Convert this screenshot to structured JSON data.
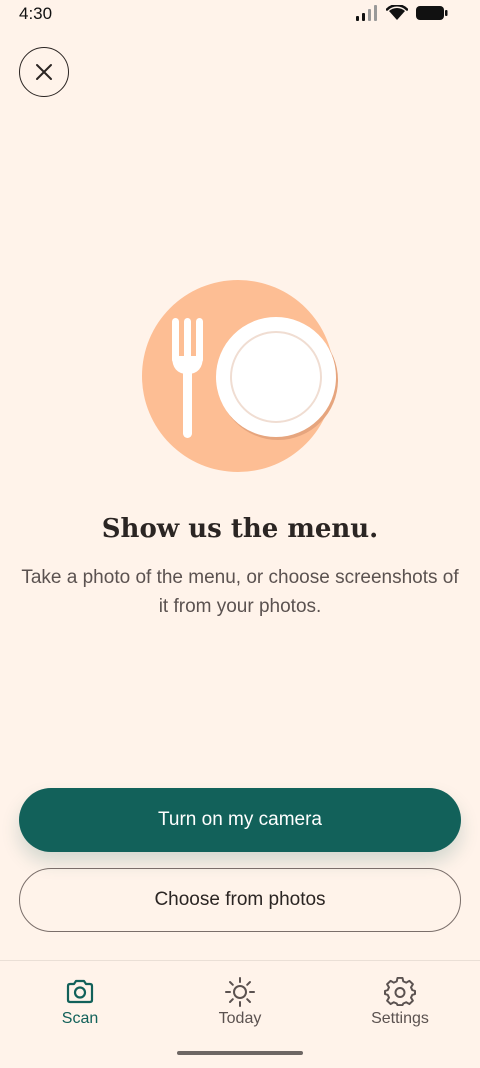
{
  "status_bar": {
    "time": "4:30",
    "icons": [
      "signal-icon",
      "wifi-icon",
      "battery-icon"
    ]
  },
  "close_button": {
    "icon": "close-icon"
  },
  "illustration": {
    "icon": "plate-fork-icon",
    "colors": {
      "circle": "#FDBE94",
      "plate": "#FFFFFF",
      "fork": "#FFFFFF"
    }
  },
  "content": {
    "headline": "Show us the menu.",
    "description": "Take a photo of the menu, or choose screenshots of it from your photos."
  },
  "actions": {
    "primary_label": "Turn on my camera",
    "secondary_label": "Choose from photos"
  },
  "bottom_nav": {
    "items": [
      {
        "label": "Scan",
        "icon": "camera-icon",
        "active": true
      },
      {
        "label": "Today",
        "icon": "sun-icon",
        "active": false
      },
      {
        "label": "Settings",
        "icon": "gear-icon",
        "active": false
      }
    ]
  },
  "colors": {
    "background": "#FFF3EA",
    "accent": "#12615A",
    "text": "#2B2523"
  }
}
